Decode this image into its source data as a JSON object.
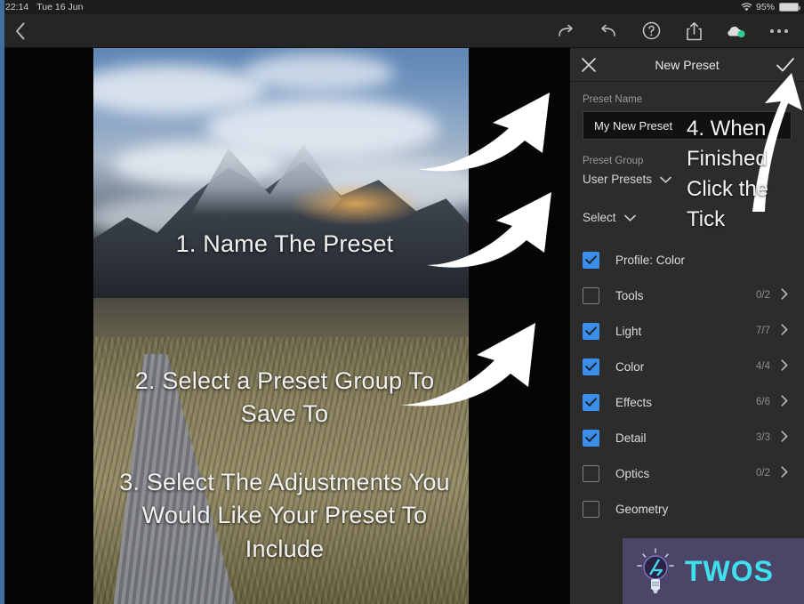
{
  "statusbar": {
    "time": "22:14",
    "date": "Tue 16 Jun",
    "battery_percent": "95%",
    "wifi_icon": "wifi-icon",
    "battery_icon": "battery-icon"
  },
  "toolbar": {
    "back_icon": "chevron-left-icon",
    "actions": [
      {
        "name": "redo-icon",
        "glyph": "redo"
      },
      {
        "name": "undo-icon",
        "glyph": "undo"
      },
      {
        "name": "help-icon",
        "glyph": "?"
      },
      {
        "name": "share-icon",
        "glyph": "share"
      },
      {
        "name": "cloud-sync-icon",
        "glyph": "cloud"
      },
      {
        "name": "more-options-icon",
        "glyph": "⋯"
      }
    ]
  },
  "panel": {
    "title": "New Preset",
    "close_icon": "close-icon",
    "confirm_icon": "check-icon",
    "preset_name_label": "Preset Name",
    "preset_name_value": "My New Preset",
    "preset_name_placeholder": "Preset Name",
    "preset_group_label": "Preset Group",
    "preset_group_value": "User Presets",
    "select_label": "Select",
    "dropdown_icon": "chevron-down-icon",
    "items": [
      {
        "label": "Profile: Color",
        "checked": true,
        "count": "",
        "chevron": false
      },
      {
        "label": "Tools",
        "checked": false,
        "count": "0/2",
        "chevron": true
      },
      {
        "label": "Light",
        "checked": true,
        "count": "7/7",
        "chevron": true
      },
      {
        "label": "Color",
        "checked": true,
        "count": "4/4",
        "chevron": true
      },
      {
        "label": "Effects",
        "checked": true,
        "count": "6/6",
        "chevron": true
      },
      {
        "label": "Detail",
        "checked": true,
        "count": "3/3",
        "chevron": true
      },
      {
        "label": "Optics",
        "checked": false,
        "count": "0/2",
        "chevron": true
      },
      {
        "label": "Geometry",
        "checked": false,
        "count": "",
        "chevron": false
      }
    ]
  },
  "annotations": {
    "step1": "1. Name The Preset",
    "step2": "2. Select a Preset Group To Save To",
    "step3": "3. Select The Adjustments You Would Like Your Preset To Include",
    "step4": "4. When Finished Click the Tick",
    "arrow_icon": "curved-arrow-icon"
  },
  "watermark": {
    "text": "TWOS",
    "logo_icon": "lightbulb-icon",
    "background_color": "#4b4668",
    "text_color": "#3fe0ee"
  },
  "colors": {
    "panel_bg": "#2c2c2c",
    "checkbox_on": "#3b8eea",
    "canvas_bg": "#050505",
    "toolbar_bg": "#252525"
  }
}
